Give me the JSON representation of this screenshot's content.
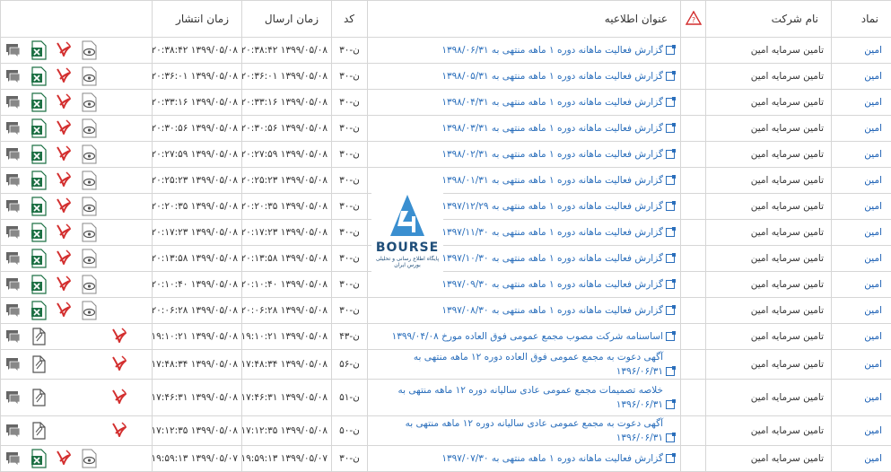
{
  "colors": {
    "link": "#2a6ebb",
    "excel": "#1e7145",
    "pdf": "#d32f2f",
    "bubble": "#666666",
    "attach": "#555555"
  },
  "headers": {
    "symbol": "نماد",
    "company": "نام شرکت",
    "title": "عنوان اطلاعیه",
    "code": "کد",
    "sent": "زمان ارسال",
    "published": "زمان انتشار"
  },
  "logo": {
    "word": "BOURSE",
    "tagline": "پایگاه اطلاع رسانی و تحلیلی بورس ایران"
  },
  "rows": [
    {
      "symbol": "امین",
      "company": "تامین سرمایه امین",
      "title": "گزارش فعالیت ماهانه دوره ۱ ماهه منتهی به ۱۳۹۸/۰۶/۳۱",
      "code": "ن-۳۰",
      "sent": "۱۳۹۹/۰۵/۰۸ ۲۰:۳۸:۴۲",
      "published": "۱۳۹۹/۰۵/۰۸ ۲۰:۳۸:۴۲",
      "kind": "excel"
    },
    {
      "symbol": "امین",
      "company": "تامین سرمایه امین",
      "title": "گزارش فعالیت ماهانه دوره ۱ ماهه منتهی به ۱۳۹۸/۰۵/۳۱",
      "code": "ن-۳۰",
      "sent": "۱۳۹۹/۰۵/۰۸ ۲۰:۳۶:۰۱",
      "published": "۱۳۹۹/۰۵/۰۸ ۲۰:۳۶:۰۱",
      "kind": "excel"
    },
    {
      "symbol": "امین",
      "company": "تامین سرمایه امین",
      "title": "گزارش فعالیت ماهانه دوره ۱ ماهه منتهی به ۱۳۹۸/۰۴/۳۱",
      "code": "ن-۳۰",
      "sent": "۱۳۹۹/۰۵/۰۸ ۲۰:۳۳:۱۶",
      "published": "۱۳۹۹/۰۵/۰۸ ۲۰:۳۳:۱۶",
      "kind": "excel"
    },
    {
      "symbol": "امین",
      "company": "تامین سرمایه امین",
      "title": "گزارش فعالیت ماهانه دوره ۱ ماهه منتهی به ۱۳۹۸/۰۳/۳۱",
      "code": "ن-۳۰",
      "sent": "۱۳۹۹/۰۵/۰۸ ۲۰:۳۰:۵۶",
      "published": "۱۳۹۹/۰۵/۰۸ ۲۰:۳۰:۵۶",
      "kind": "excel"
    },
    {
      "symbol": "امین",
      "company": "تامین سرمایه امین",
      "title": "گزارش فعالیت ماهانه دوره ۱ ماهه منتهی به ۱۳۹۸/۰۲/۳۱",
      "code": "ن-۳۰",
      "sent": "۱۳۹۹/۰۵/۰۸ ۲۰:۲۷:۵۹",
      "published": "۱۳۹۹/۰۵/۰۸ ۲۰:۲۷:۵۹",
      "kind": "excel"
    },
    {
      "symbol": "امین",
      "company": "تامین سرمایه امین",
      "title": "گزارش فعالیت ماهانه دوره ۱ ماهه منتهی به ۱۳۹۸/۰۱/۳۱",
      "code": "ن-۳۰",
      "sent": "۱۳۹۹/۰۵/۰۸ ۲۰:۲۵:۲۳",
      "published": "۱۳۹۹/۰۵/۰۸ ۲۰:۲۵:۲۳",
      "kind": "excel"
    },
    {
      "symbol": "امین",
      "company": "تامین سرمایه امین",
      "title": "گزارش فعالیت ماهانه دوره ۱ ماهه منتهی به ۱۳۹۷/۱۲/۲۹",
      "code": "ن-۳۰",
      "sent": "۱۳۹۹/۰۵/۰۸ ۲۰:۲۰:۳۵",
      "published": "۱۳۹۹/۰۵/۰۸ ۲۰:۲۰:۳۵",
      "kind": "excel"
    },
    {
      "symbol": "امین",
      "company": "تامین سرمایه امین",
      "title": "گزارش فعالیت ماهانه دوره ۱ ماهه منتهی به ۱۳۹۷/۱۱/۳۰",
      "code": "ن-۳۰",
      "sent": "۱۳۹۹/۰۵/۰۸ ۲۰:۱۷:۲۳",
      "published": "۱۳۹۹/۰۵/۰۸ ۲۰:۱۷:۲۳",
      "kind": "excel"
    },
    {
      "symbol": "امین",
      "company": "تامین سرمایه امین",
      "title": "گزارش فعالیت ماهانه دوره ۱ ماهه منتهی به ۱۳۹۷/۱۰/۳۰",
      "code": "ن-۳۰",
      "sent": "۱۳۹۹/۰۵/۰۸ ۲۰:۱۳:۵۸",
      "published": "۱۳۹۹/۰۵/۰۸ ۲۰:۱۳:۵۸",
      "kind": "excel"
    },
    {
      "symbol": "امین",
      "company": "تامین سرمایه امین",
      "title": "گزارش فعالیت ماهانه دوره ۱ ماهه منتهی به ۱۳۹۷/۰۹/۳۰",
      "code": "ن-۳۰",
      "sent": "۱۳۹۹/۰۵/۰۸ ۲۰:۱۰:۴۰",
      "published": "۱۳۹۹/۰۵/۰۸ ۲۰:۱۰:۴۰",
      "kind": "excel"
    },
    {
      "symbol": "امین",
      "company": "تامین سرمایه امین",
      "title": "گزارش فعالیت ماهانه دوره ۱ ماهه منتهی به ۱۳۹۷/۰۸/۳۰",
      "code": "ن-۳۰",
      "sent": "۱۳۹۹/۰۵/۰۸ ۲۰:۰۶:۲۸",
      "published": "۱۳۹۹/۰۵/۰۸ ۲۰:۰۶:۲۸",
      "kind": "excel"
    },
    {
      "symbol": "امین",
      "company": "تامین سرمایه امین",
      "title": "اساسنامه شرکت مصوب مجمع عمومی فوق العاده مورخ ۱۳۹۹/۰۴/۰۸",
      "code": "ن-۴۳",
      "sent": "۱۳۹۹/۰۵/۰۸ ۱۹:۱۰:۲۱",
      "published": "۱۳۹۹/۰۵/۰۸ ۱۹:۱۰:۲۱",
      "kind": "attach"
    },
    {
      "symbol": "امین",
      "company": "تامین سرمایه امین",
      "title": "آگهی دعوت به مجمع عمومی فوق العاده دوره ۱۲ ماهه منتهی به ۱۳۹۶/۰۶/۳۱",
      "code": "ن-۵۶",
      "sent": "۱۳۹۹/۰۵/۰۸ ۱۷:۴۸:۳۴",
      "published": "۱۳۹۹/۰۵/۰۸ ۱۷:۴۸:۳۴",
      "kind": "attach"
    },
    {
      "symbol": "امین",
      "company": "تامین سرمایه امین",
      "title": "خلاصه تصمیمات مجمع عمومی عادی سالیانه دوره ۱۲ ماهه منتهی به ۱۳۹۶/۰۶/۳۱",
      "code": "ن-۵۱",
      "sent": "۱۳۹۹/۰۵/۰۸ ۱۷:۴۶:۳۱",
      "published": "۱۳۹۹/۰۵/۰۸ ۱۷:۴۶:۳۱",
      "kind": "attach",
      "tall": true
    },
    {
      "symbol": "امین",
      "company": "تامین سرمایه امین",
      "title": "آگهی دعوت به مجمع عمومی عادی سالیانه دوره ۱۲ ماهه منتهی به ۱۳۹۶/۰۶/۳۱",
      "code": "ن-۵۰",
      "sent": "۱۳۹۹/۰۵/۰۸ ۱۷:۱۲:۳۵",
      "published": "۱۳۹۹/۰۵/۰۸ ۱۷:۱۲:۳۵",
      "kind": "attach"
    },
    {
      "symbol": "امین",
      "company": "تامین سرمایه امین",
      "title": "گزارش فعالیت ماهانه دوره ۱ ماهه منتهی به ۱۳۹۷/۰۷/۳۰",
      "code": "ن-۳۰",
      "sent": "۱۳۹۹/۰۵/۰۷ ۱۹:۵۹:۱۳",
      "published": "۱۳۹۹/۰۵/۰۷ ۱۹:۵۹:۱۳",
      "kind": "excel"
    }
  ]
}
